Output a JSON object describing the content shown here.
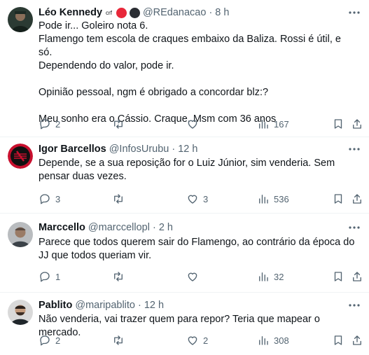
{
  "tweets": [
    {
      "name": "Léo Kennedy",
      "name_suffix": "crf",
      "handle": "@REdanacao",
      "sep": "·",
      "time": "8 h",
      "text": "Pode ir... Goleiro nota 6.\nFlamengo tem escola de craques embaixo da Baliza. Rossi é útil, e só.\nDependendo do valor, pode ir.\n\nOpinião pessoal, ngm é obrigado a concordar blz:?\n\nMeu sonho era o Cássio. Craque. Msm com 36 anos",
      "replies": "2",
      "retweets": "",
      "likes": "",
      "views": "167",
      "badge_colors": [
        "#e8283a",
        "#2a2d33"
      ]
    },
    {
      "name": "Igor Barcellos",
      "handle": "@InfosUrubu",
      "sep": "·",
      "time": "12 h",
      "text": "Depende, se a sua reposição for o Luiz Júnior, sim venderia. Sem pensar duas vezes.",
      "replies": "3",
      "retweets": "",
      "likes": "3",
      "views": "536"
    },
    {
      "name": "Marccello",
      "handle": "@marccellopl",
      "sep": "·",
      "time": "2 h",
      "text": "Parece que todos querem sair do Flamengo, ao contrário da época do JJ que todos queriam vir.",
      "replies": "1",
      "retweets": "",
      "likes": "",
      "views": "32"
    },
    {
      "name": "Pablito",
      "handle": "@maripablito",
      "sep": "·",
      "time": "12 h",
      "text": "Não venderia, vai trazer quem para repor? Teria que mapear o mercado.",
      "replies": "2",
      "retweets": "",
      "likes": "2",
      "views": "308"
    }
  ],
  "colors": {
    "text": "#0f1419",
    "secondary": "#536471",
    "divider": "#eff3f4",
    "flamengo_red": "#c8102e"
  },
  "icons": [
    "more-icon",
    "reply-icon",
    "retweet-icon",
    "like-icon",
    "views-icon",
    "bookmark-icon",
    "share-icon"
  ]
}
